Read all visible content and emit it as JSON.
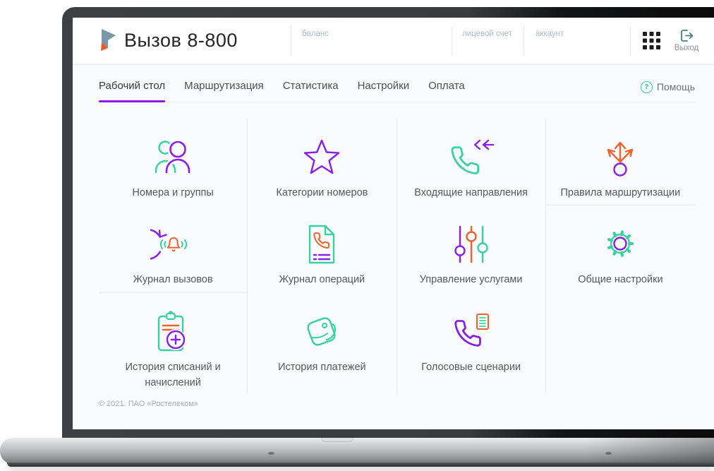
{
  "app": {
    "title": "Вызов 8-800"
  },
  "header": {
    "fields": [
      {
        "label": "баланс"
      },
      {
        "label": "лицевой счет"
      },
      {
        "label": "аккаунт"
      }
    ],
    "logout_label": "Выход"
  },
  "nav": {
    "tabs": [
      {
        "label": "Рабочий стол",
        "active": true
      },
      {
        "label": "Маршрутизация",
        "active": false
      },
      {
        "label": "Статистика",
        "active": false
      },
      {
        "label": "Настройки",
        "active": false
      },
      {
        "label": "Оплата",
        "active": false
      }
    ],
    "help_label": "Помощь",
    "help_icon": "question-circle-icon"
  },
  "tiles": [
    {
      "label": "Номера и группы",
      "icon": "users-icon"
    },
    {
      "label": "Категории номеров",
      "icon": "star-icon"
    },
    {
      "label": "Входящие направления",
      "icon": "incoming-phone-icon"
    },
    {
      "label": "Правила маршрутизации",
      "icon": "routing-arrows-icon"
    },
    {
      "label": "Журнал вызовов",
      "icon": "call-log-icon"
    },
    {
      "label": "Журнал операций",
      "icon": "operations-log-icon"
    },
    {
      "label": "Управление услугами",
      "icon": "sliders-icon"
    },
    {
      "label": "Общие настройки",
      "icon": "gear-icon"
    },
    {
      "label": "История списаний и начислений",
      "icon": "clipboard-plus-icon"
    },
    {
      "label": "История платежей",
      "icon": "wallet-icon"
    },
    {
      "label": "Голосовые сценарии",
      "icon": "voice-script-icon"
    }
  ],
  "footer": {
    "copyright": "© 2021. ПАО «Ростелеком»"
  },
  "colors": {
    "accent_purple": "#8B1FE8",
    "accent_teal": "#35D3A0",
    "accent_orange": "#F2612D",
    "help_green": "#2ECC8E",
    "logo_gray": "#7B96A4",
    "logo_orange": "#F0552A"
  }
}
